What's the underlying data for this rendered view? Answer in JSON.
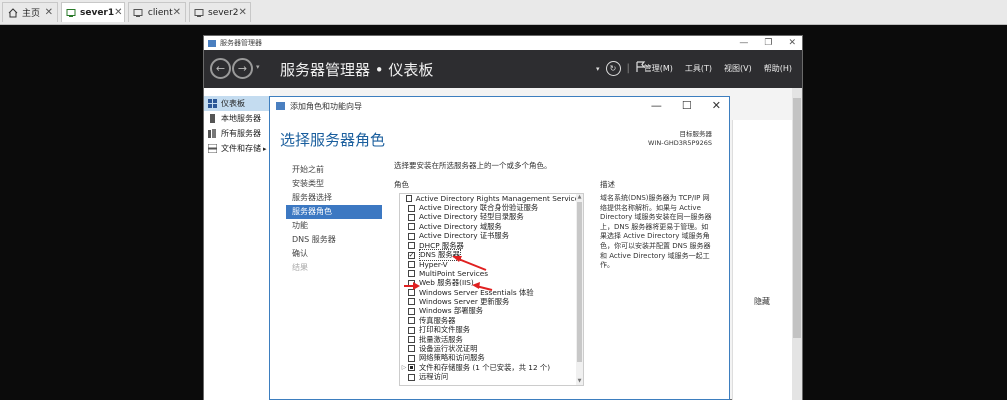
{
  "tabs": [
    {
      "label": "主页",
      "icon": "home-icon",
      "active": false
    },
    {
      "label": "sever1",
      "icon": "vm-icon",
      "active": true
    },
    {
      "label": "client",
      "icon": "vm-icon",
      "active": false
    },
    {
      "label": "sever2",
      "icon": "vm-icon",
      "active": false
    }
  ],
  "server_manager": {
    "window_title": "服务器管理器",
    "title": "服务器管理器 • 仪表板",
    "menus": [
      "管理(M)",
      "工具(T)",
      "视图(V)",
      "帮助(H)"
    ],
    "sidebar": [
      {
        "label": "仪表板",
        "icon": "dashboard-icon"
      },
      {
        "label": "本地服务器",
        "icon": "server-icon"
      },
      {
        "label": "所有服务器",
        "icon": "servers-icon"
      },
      {
        "label": "文件和存储",
        "icon": "storage-icon"
      }
    ],
    "hide_label": "隐藏"
  },
  "wizard": {
    "window_title": "添加角色和功能向导",
    "heading": "选择服务器角色",
    "target_label": "目标服务器",
    "target_name": "WIN-GHD3R5P926S",
    "nav": [
      {
        "label": "开始之前",
        "state": "normal"
      },
      {
        "label": "安装类型",
        "state": "normal"
      },
      {
        "label": "服务器选择",
        "state": "normal"
      },
      {
        "label": "服务器角色",
        "state": "active"
      },
      {
        "label": "功能",
        "state": "normal"
      },
      {
        "label": "DNS 服务器",
        "state": "normal"
      },
      {
        "label": "确认",
        "state": "normal"
      },
      {
        "label": "结果",
        "state": "disabled"
      }
    ],
    "instruction": "选择要安装在所选服务器上的一个或多个角色。",
    "roles_header": "角色",
    "description_header": "描述",
    "description": "域名系统(DNS)服务器为 TCP/IP 网络提供名称解析。如果与 Active Directory 域服务安装在同一服务器上，DNS 服务器将更易于管理。如果选择 Active Directory 域服务角色，你可以安装并配置 DNS 服务器和 Active Directory 域服务一起工作。",
    "roles": [
      {
        "label": "Active Directory Rights Management Services",
        "state": "unchecked",
        "expand": false
      },
      {
        "label": "Active Directory 联合身份验证服务",
        "state": "unchecked",
        "expand": false
      },
      {
        "label": "Active Directory 轻型目录服务",
        "state": "unchecked",
        "expand": false
      },
      {
        "label": "Active Directory 域服务",
        "state": "unchecked",
        "expand": false
      },
      {
        "label": "Active Directory 证书服务",
        "state": "unchecked",
        "expand": false
      },
      {
        "label": "DHCP 服务器",
        "state": "unchecked",
        "expand": false
      },
      {
        "label": "DNS 服务器",
        "state": "checked",
        "expand": false
      },
      {
        "label": "Hyper-V",
        "state": "unchecked",
        "expand": false
      },
      {
        "label": "MultiPoint Services",
        "state": "unchecked",
        "expand": false
      },
      {
        "label": "Web 服务器(IIS)",
        "state": "unchecked",
        "expand": false
      },
      {
        "label": "Windows Server Essentials 体验",
        "state": "unchecked",
        "expand": false
      },
      {
        "label": "Windows Server 更新服务",
        "state": "unchecked",
        "expand": false
      },
      {
        "label": "Windows 部署服务",
        "state": "unchecked",
        "expand": false
      },
      {
        "label": "传真服务器",
        "state": "unchecked",
        "expand": false
      },
      {
        "label": "打印和文件服务",
        "state": "unchecked",
        "expand": false
      },
      {
        "label": "批量激活服务",
        "state": "unchecked",
        "expand": false
      },
      {
        "label": "设备运行状况证明",
        "state": "unchecked",
        "expand": false
      },
      {
        "label": "网络策略和访问服务",
        "state": "unchecked",
        "expand": false
      },
      {
        "label": "文件和存储服务 (1 个已安装，共 12 个)",
        "state": "partial",
        "expand": true
      },
      {
        "label": "远程访问",
        "state": "unchecked",
        "expand": false
      }
    ],
    "annotation_color": "#e02020"
  }
}
